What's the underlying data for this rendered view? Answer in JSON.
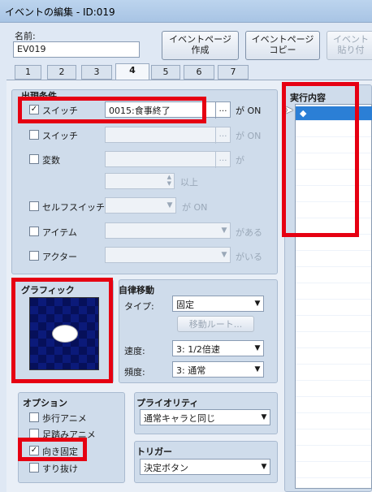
{
  "window": {
    "title": "イベントの編集 - ID:019"
  },
  "name": {
    "label": "名前:",
    "value": "EV019"
  },
  "buttons": {
    "create_page_line1": "イベントページ",
    "create_page_line2": "作成",
    "copy_page_line1": "イベントページ",
    "copy_page_line2": "コピー",
    "paste_page_line1": "イベント",
    "paste_page_line2": "貼り付"
  },
  "tabs": [
    "1",
    "2",
    "3",
    "4",
    "5",
    "6",
    "7"
  ],
  "conditions": {
    "title": "出現条件",
    "switch1_label": "スイッチ",
    "switch1_value": "0015:食事終了",
    "switch1_suffix": "が ON",
    "switch2_label": "スイッチ",
    "switch2_suffix": "が ON",
    "variable_label": "変数",
    "variable_suffix": "が",
    "variable_ge": "以上",
    "self_switch_label": "セルフスイッチ",
    "self_switch_suffix": "が ON",
    "item_label": "アイテム",
    "item_suffix": "がある",
    "actor_label": "アクター",
    "actor_suffix": "がいる",
    "ellipsis": "…"
  },
  "graphic": {
    "title": "グラフィック"
  },
  "autonomous": {
    "title": "自律移動",
    "type_label": "タイプ:",
    "type_value": "固定",
    "route_button": "移動ルート...",
    "speed_label": "速度:",
    "speed_value": "3: 1/2倍速",
    "freq_label": "頻度:",
    "freq_value": "3: 通常"
  },
  "options": {
    "title": "オプション",
    "walk": "歩行アニメ",
    "step": "足踏みアニメ",
    "dir_fix": "向き固定",
    "through": "すり抜け"
  },
  "priority": {
    "title": "プライオリティ",
    "value": "通常キャラと同じ"
  },
  "trigger": {
    "title": "トリガー",
    "value": "決定ボタン"
  },
  "content": {
    "title": "実行内容",
    "first_item": "◆"
  },
  "colors": {
    "highlight": "#e60012",
    "selection": "#2b7fd6"
  }
}
